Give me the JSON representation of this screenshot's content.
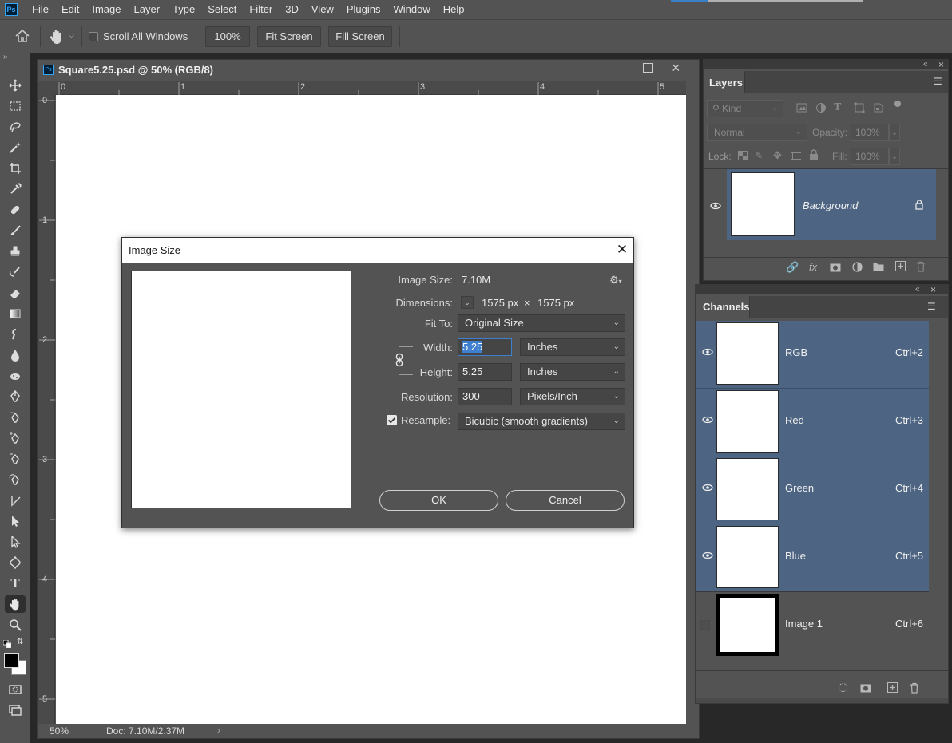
{
  "app": {
    "logo": "Ps",
    "menu": [
      "File",
      "Edit",
      "Image",
      "Layer",
      "Type",
      "Select",
      "Filter",
      "3D",
      "View",
      "Plugins",
      "Window",
      "Help"
    ]
  },
  "options": {
    "scroll_all_windows": "Scroll All Windows",
    "zoom": "100%",
    "fit_screen": "Fit Screen",
    "fill_screen": "Fill Screen"
  },
  "document": {
    "title": "Square5.25.psd @ 50% (RGB/8)",
    "ruler_top": [
      "0",
      "1",
      "2",
      "3",
      "4",
      "5"
    ],
    "ruler_left": [
      "0",
      "1",
      "2",
      "3",
      "4",
      "5"
    ],
    "zoom_status": "50%",
    "doc_status": "Doc: 7.10M/2.37M"
  },
  "layers": {
    "tab": "Layers",
    "kind": "Kind",
    "blend_mode": "Normal",
    "opacity_label": "Opacity:",
    "opacity_value": "100%",
    "lock_label": "Lock:",
    "fill_label": "Fill:",
    "fill_value": "100%",
    "items": [
      {
        "name": "Background"
      }
    ]
  },
  "channels": {
    "tab": "Channels",
    "items": [
      {
        "name": "RGB",
        "shortcut": "Ctrl+2"
      },
      {
        "name": "Red",
        "shortcut": "Ctrl+3"
      },
      {
        "name": "Green",
        "shortcut": "Ctrl+4"
      },
      {
        "name": "Blue",
        "shortcut": "Ctrl+5"
      },
      {
        "name": "Image 1",
        "shortcut": "Ctrl+6"
      }
    ]
  },
  "dialog": {
    "title": "Image Size",
    "image_size_label": "Image Size:",
    "image_size_value": "7.10M",
    "dimensions_label": "Dimensions:",
    "dim_width": "1575 px",
    "dim_x": "×",
    "dim_height": "1575 px",
    "fit_to_label": "Fit To:",
    "fit_to_value": "Original Size",
    "width_label": "Width:",
    "width_value": "5.25",
    "width_unit": "Inches",
    "height_label": "Height:",
    "height_value": "5.25",
    "height_unit": "Inches",
    "resolution_label": "Resolution:",
    "resolution_value": "300",
    "resolution_unit": "Pixels/Inch",
    "resample_label": "Resample:",
    "resample_value": "Bicubic (smooth gradients)",
    "ok": "OK",
    "cancel": "Cancel"
  }
}
